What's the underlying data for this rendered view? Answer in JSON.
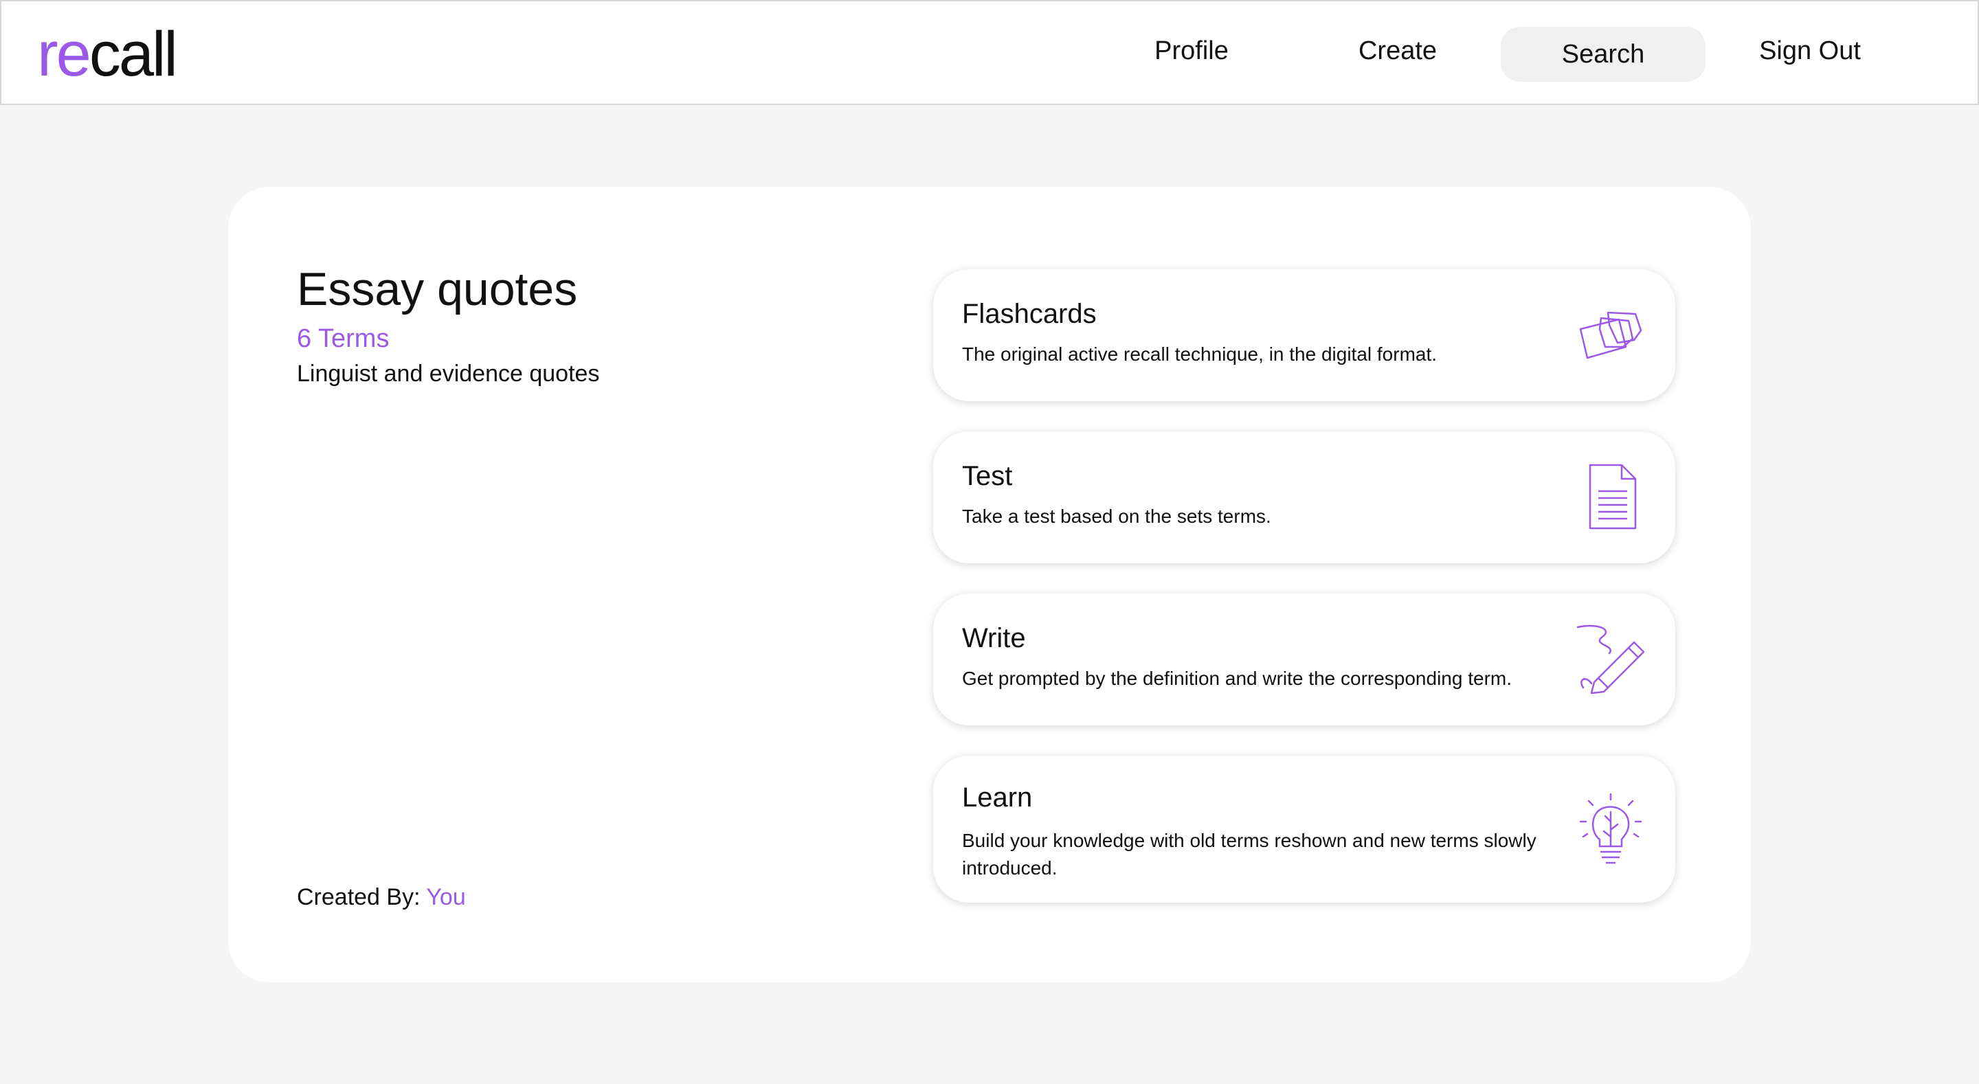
{
  "header": {
    "logo_accent": "re",
    "logo_rest": "call",
    "nav": {
      "profile": "Profile",
      "create": "Create",
      "search": "Search",
      "sign_out": "Sign Out"
    }
  },
  "set": {
    "title": "Essay quotes",
    "terms": "6 Terms",
    "description": "Linguist and evidence quotes",
    "created_by_label": "Created By:",
    "created_by_value": "You"
  },
  "modes": [
    {
      "title": "Flashcards",
      "description": "The original active recall technique, in the digital format.",
      "icon": "flashcards-icon"
    },
    {
      "title": "Test",
      "description": "Take a test based on the sets terms.",
      "icon": "document-icon"
    },
    {
      "title": "Write",
      "description": "Get prompted by the definition and write the corresponding term.",
      "icon": "pencil-icon"
    },
    {
      "title": "Learn",
      "description": "Build your knowledge with old terms reshown and new terms slowly introduced.",
      "icon": "lightbulb-icon"
    }
  ],
  "colors": {
    "accent": "#9b59e8",
    "background": "#f5f5f5",
    "card": "#ffffff",
    "search_highlight": "#f0f0f0"
  }
}
